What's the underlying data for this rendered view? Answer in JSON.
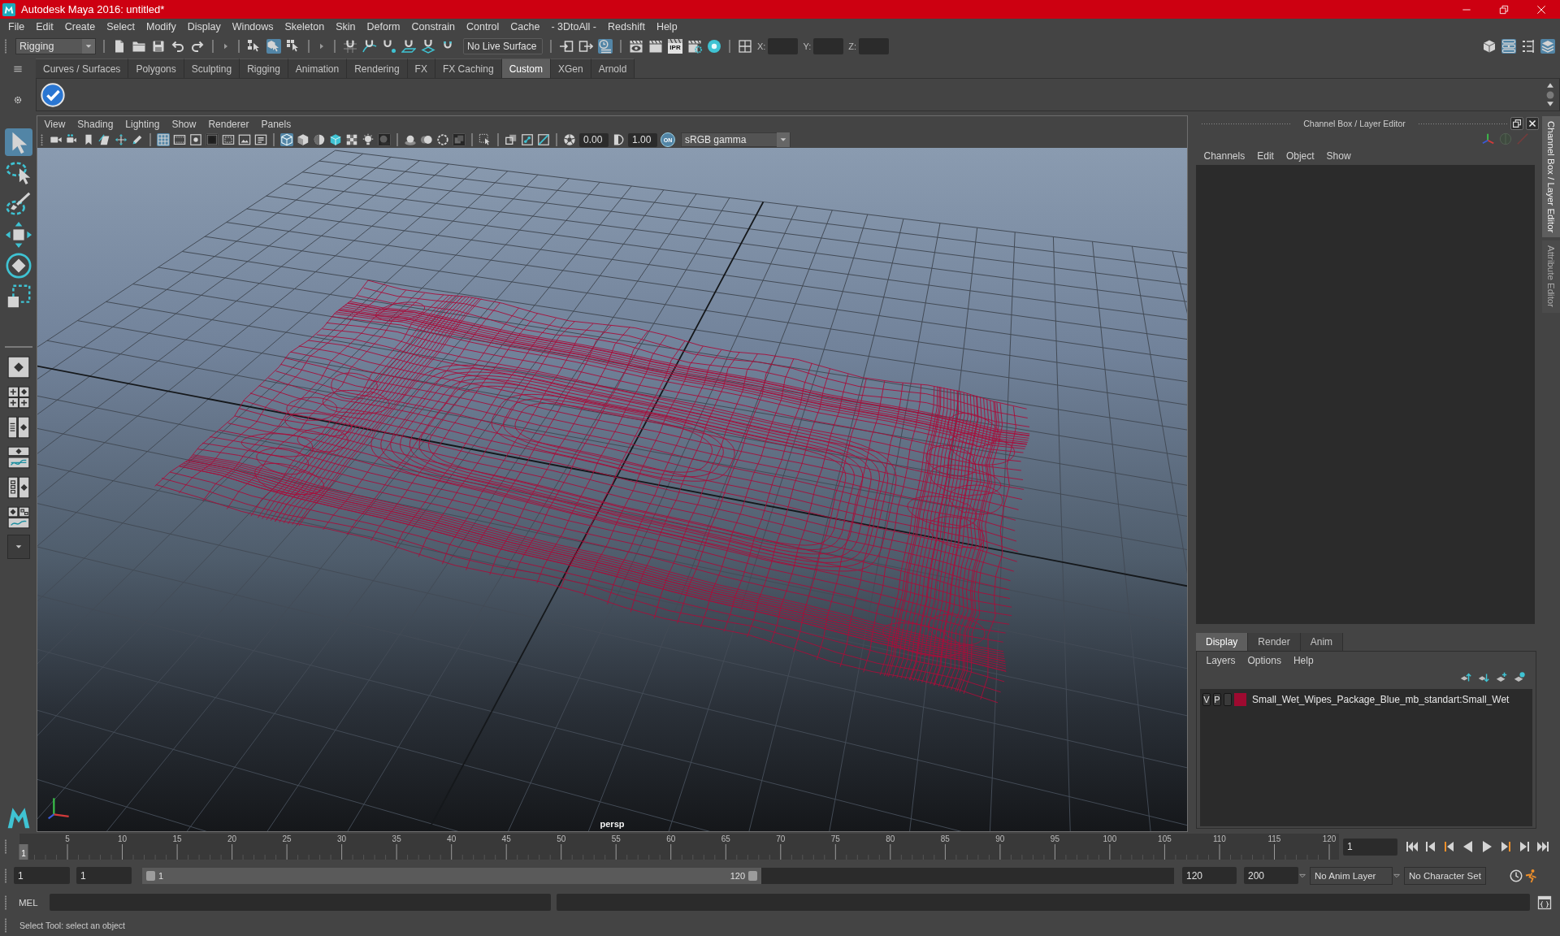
{
  "title_bar": {
    "title": "Autodesk Maya 2016: untitled*"
  },
  "menu_bar": {
    "items": [
      "File",
      "Edit",
      "Create",
      "Select",
      "Modify",
      "Display",
      "Windows",
      "Skeleton",
      "Skin",
      "Deform",
      "Constrain",
      "Control",
      "Cache",
      "- 3DtoAll -",
      "Redshift",
      "Help"
    ]
  },
  "status_line": {
    "menu_set": "Rigging",
    "select_modes": [
      {
        "selected": false
      },
      {
        "selected": true
      },
      {
        "selected": false
      }
    ],
    "live_surface": "No Live Surface",
    "history_toggles": [
      {
        "on": false
      },
      {
        "on": false
      },
      {
        "on": true
      }
    ],
    "ipr_label": "IPR",
    "coordinates": [
      {
        "label": "X:"
      },
      {
        "label": "Y:"
      },
      {
        "label": "Z:"
      }
    ],
    "panel_toggles": [
      {
        "on": false
      },
      {
        "on": true
      },
      {
        "on": false
      },
      {
        "on": true
      }
    ]
  },
  "shelf": {
    "tabs": [
      {
        "label": "Curves / Surfaces",
        "selected": false
      },
      {
        "label": "Polygons",
        "selected": false
      },
      {
        "label": "Sculpting",
        "selected": false
      },
      {
        "label": "Rigging",
        "selected": false
      },
      {
        "label": "Animation",
        "selected": false
      },
      {
        "label": "Rendering",
        "selected": false
      },
      {
        "label": "FX",
        "selected": false
      },
      {
        "label": "FX Caching",
        "selected": false
      },
      {
        "label": "Custom",
        "selected": true
      },
      {
        "label": "XGen",
        "selected": false
      },
      {
        "label": "Arnold",
        "selected": false
      }
    ]
  },
  "toolbox": {
    "tools": [
      {
        "selected": true
      },
      {
        "selected": false
      },
      {
        "selected": false
      },
      {
        "selected": false
      },
      {
        "selected": false
      },
      {
        "selected": false
      }
    ]
  },
  "viewport": {
    "menus": [
      "View",
      "Shading",
      "Lighting",
      "Show",
      "Renderer",
      "Panels"
    ],
    "gate_toggles": [
      {
        "on": true,
        "disabled": false
      },
      {
        "on": false,
        "disabled": false
      },
      {
        "on": false,
        "disabled": false
      },
      {
        "on": false,
        "disabled": true
      },
      {
        "on": false,
        "disabled": false
      },
      {
        "on": false,
        "disabled": false
      },
      {
        "on": false,
        "disabled": false
      }
    ],
    "shading_toggles": [
      {
        "on": true,
        "disabled": false
      },
      {
        "on": false,
        "disabled": false
      },
      {
        "on": false,
        "disabled": false
      },
      {
        "on": false,
        "disabled": false
      },
      {
        "on": false,
        "disabled": false
      },
      {
        "on": false,
        "disabled": false
      },
      {
        "on": false,
        "disabled": true
      }
    ],
    "render_toggles": [
      {
        "on": false,
        "disabled": false
      },
      {
        "on": false,
        "disabled": false
      },
      {
        "on": false,
        "disabled": false
      },
      {
        "on": false,
        "disabled": true
      }
    ],
    "exposure": "0.00",
    "gamma": "1.00",
    "color_management": {
      "label": "ON",
      "on": true
    },
    "view_transform": "sRGB gamma",
    "camera_label": "persp"
  },
  "channel_box": {
    "title": "Channel Box / Layer Editor",
    "menus": [
      "Channels",
      "Edit",
      "Object",
      "Show"
    ]
  },
  "layer_editor": {
    "tabs": [
      {
        "label": "Display",
        "selected": true
      },
      {
        "label": "Render",
        "selected": false
      },
      {
        "label": "Anim",
        "selected": false
      }
    ],
    "menus": [
      "Layers",
      "Options",
      "Help"
    ],
    "layers": [
      {
        "visibility": "V",
        "playback": "P",
        "color": "#9e0a30",
        "name": "Small_Wet_Wipes_Package_Blue_mb_standart:Small_Wet"
      }
    ]
  },
  "side_tabs": [
    {
      "label": "Channel Box / Layer Editor",
      "selected": true
    },
    {
      "label": "Attribute Editor",
      "selected": false
    }
  ],
  "time_slider": {
    "frame_labels": [
      "5",
      "10",
      "15",
      "20",
      "25",
      "30",
      "35",
      "40",
      "45",
      "50",
      "55",
      "60",
      "65",
      "70",
      "75",
      "80",
      "85",
      "90",
      "95",
      "100",
      "105",
      "110",
      "115",
      "120"
    ],
    "current_frame_marker": "1",
    "level": 0,
    "current_frame": "1"
  },
  "range_slider": {
    "animation_start": "1",
    "playback_start": "1",
    "range_start_label": "1",
    "range_end_label": "120",
    "level": 0.6,
    "playback_end": "120",
    "animation_end": "200",
    "anim_layer": "No Anim Layer",
    "character_set": "No Character Set"
  },
  "command_line": {
    "language": "MEL"
  },
  "help_line": {
    "text": "Select Tool: select an object"
  }
}
